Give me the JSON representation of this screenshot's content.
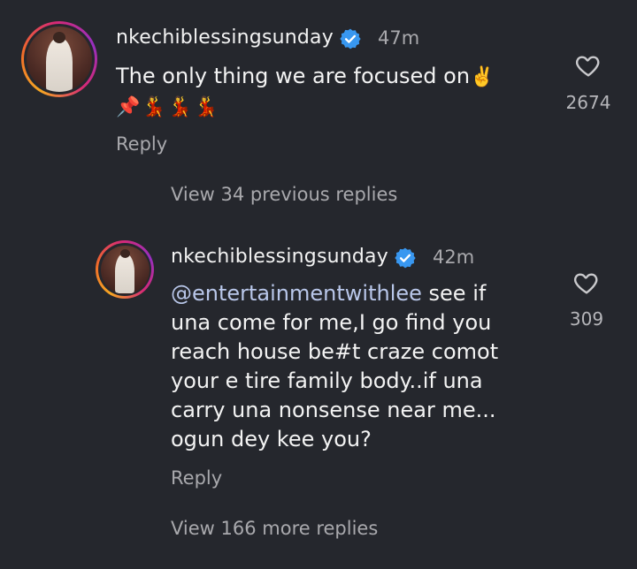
{
  "comments": [
    {
      "username": "nkechiblessingsunday",
      "time": "47m",
      "text_line1": "The only thing we are focused on",
      "text_line1_emoji": "✌️",
      "text_line2_emojis": "📌💃💃💃",
      "reply_label": "Reply",
      "likes": "2674"
    },
    {
      "username": "nkechiblessingsunday",
      "time": "42m",
      "mention": "@entertainmentwithlee",
      "text_lines": [
        " see if",
        "una come for me,I go find you",
        "reach house be#t craze comot",
        "your e tire family body..if una",
        "carry una nonsense near me...",
        "ogun dey kee you?"
      ],
      "reply_label": "Reply",
      "likes": "309"
    }
  ],
  "view_previous_replies": "View 34 previous replies",
  "view_more_replies": "View 166 more replies",
  "colors": {
    "background": "#25272d",
    "verified": "#3897f0",
    "mention": "#b9c7ea",
    "muted": "#a9a9ad"
  },
  "icons": {
    "verified": "verified-badge-icon",
    "like": "heart-outline-icon"
  }
}
